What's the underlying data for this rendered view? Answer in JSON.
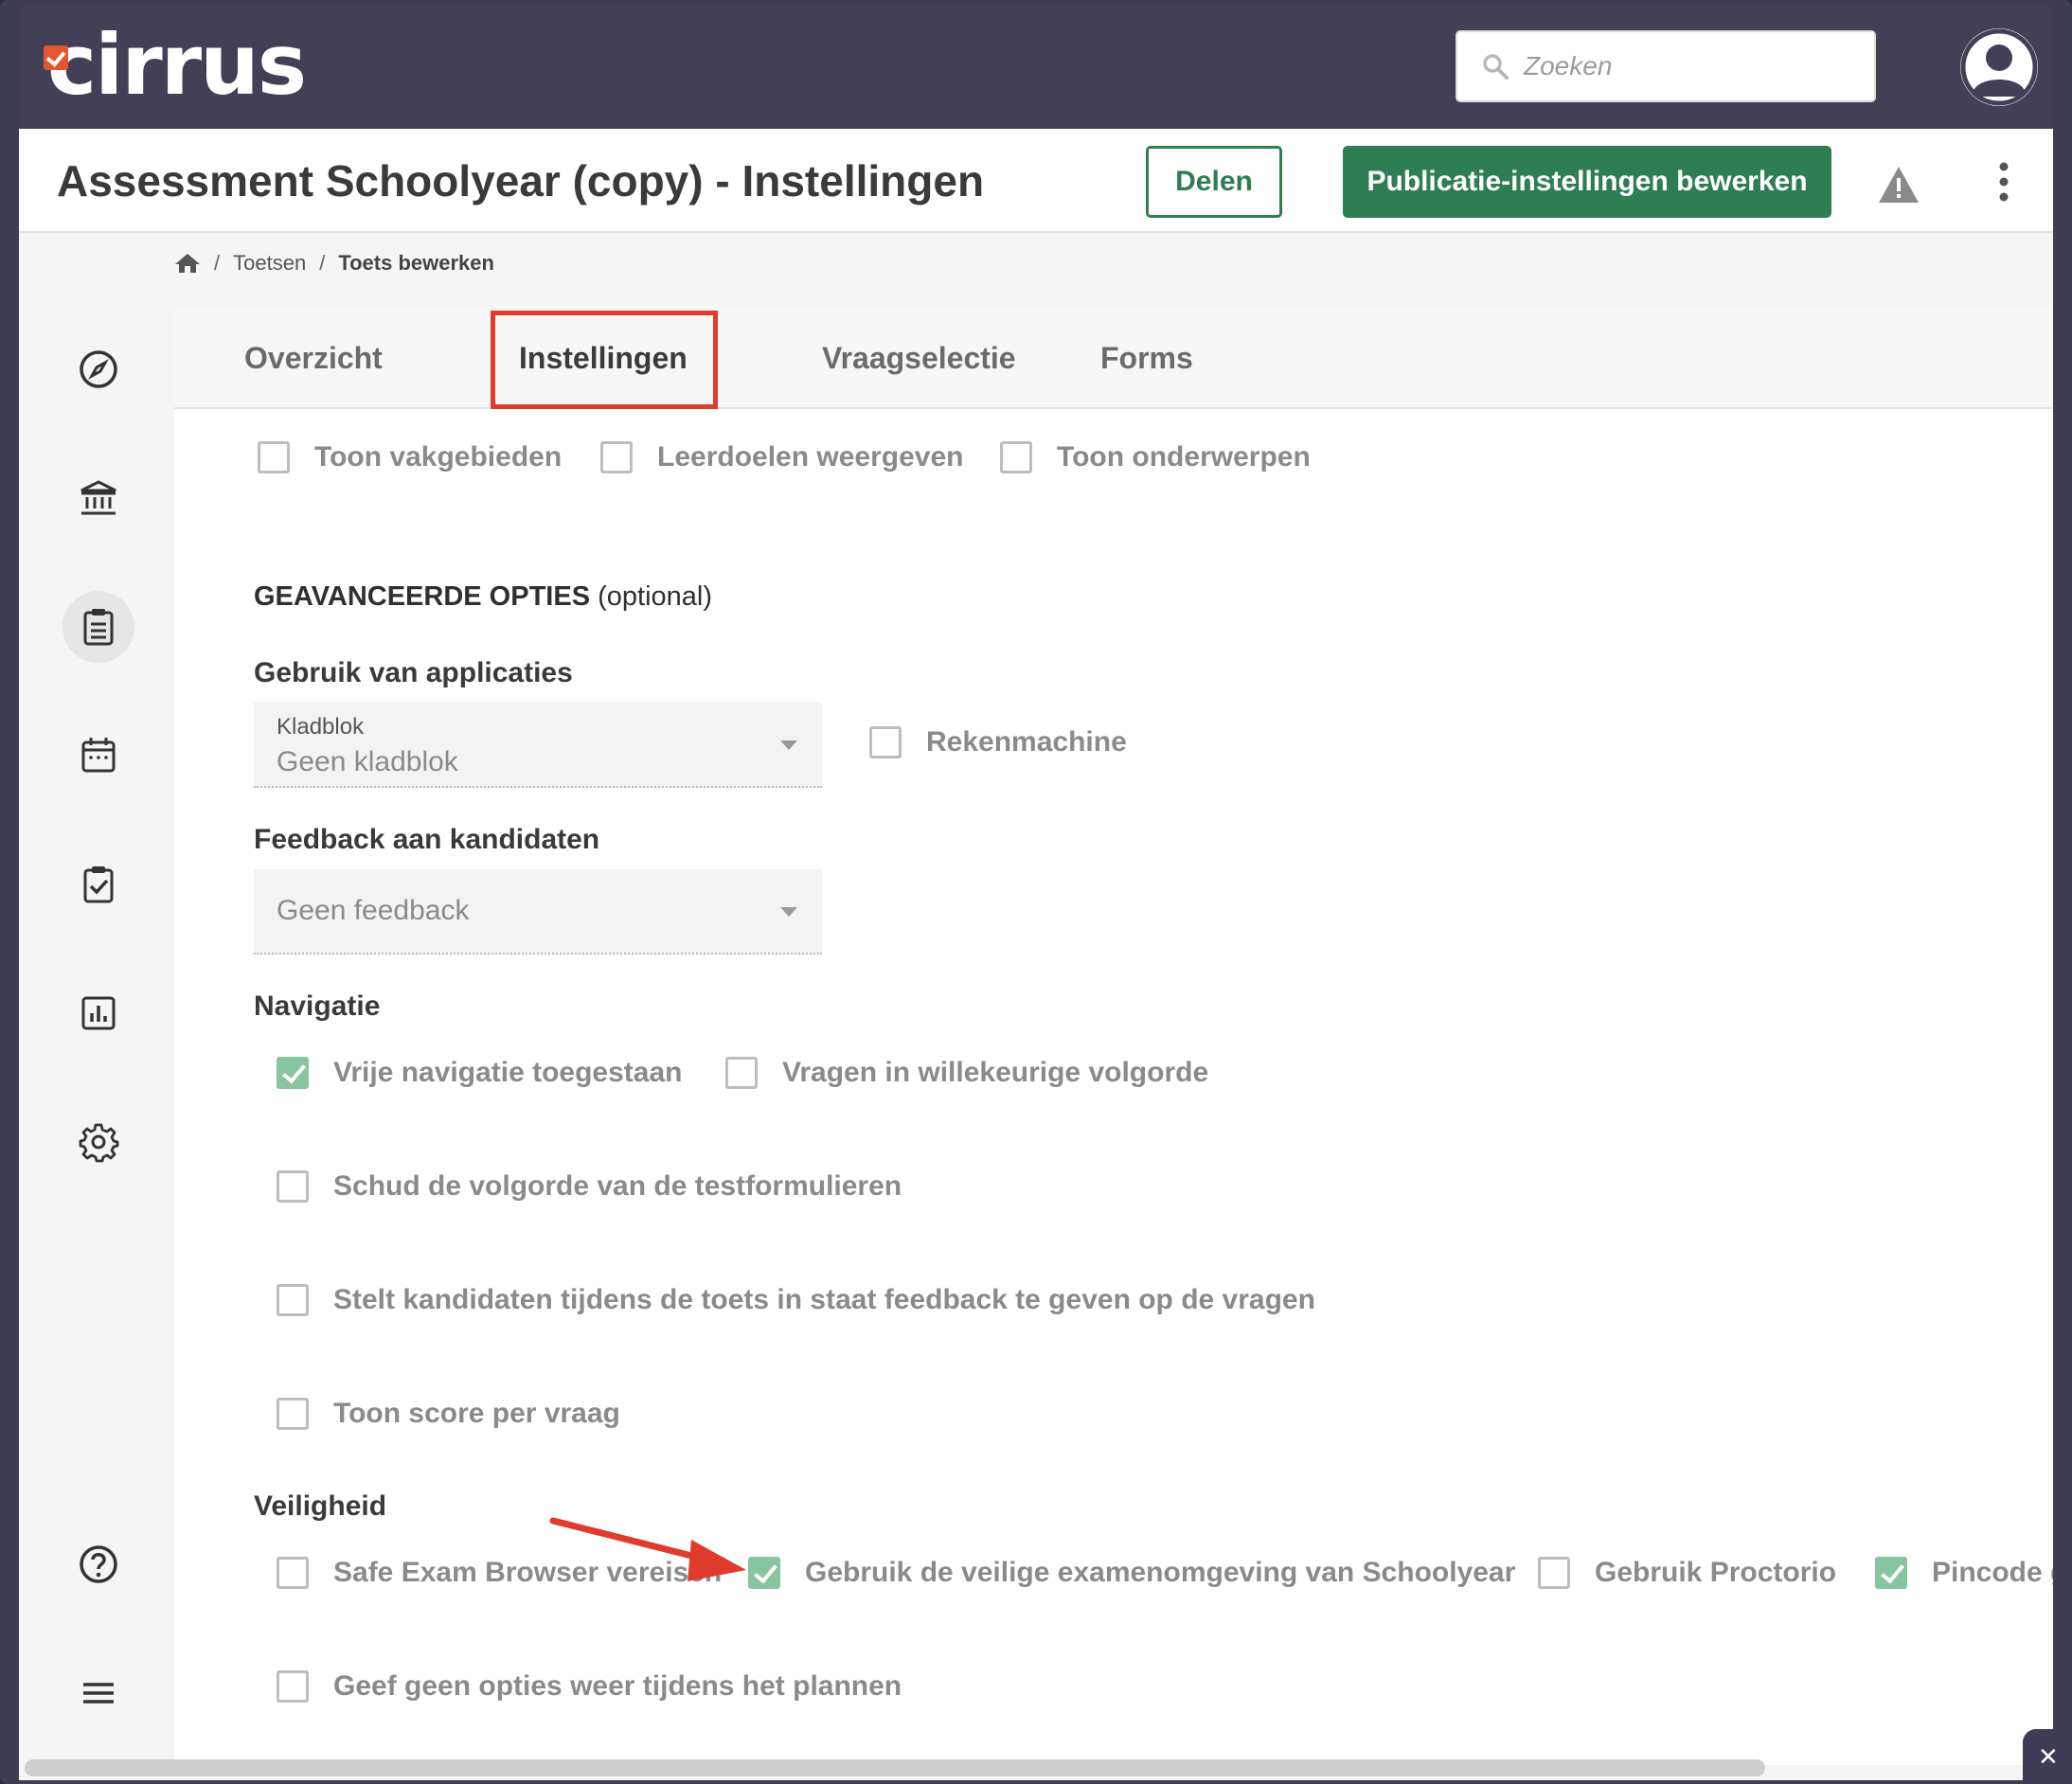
{
  "app": {
    "logo_text": "cirrus"
  },
  "search": {
    "placeholder": "Zoeken"
  },
  "header": {
    "title": "Assessment Schoolyear (copy) - Instellingen",
    "share_label": "Delen",
    "publish_label": "Publicatie-instellingen bewerken"
  },
  "breadcrumb": {
    "items": [
      "Toetsen",
      "Toets bewerken"
    ]
  },
  "tabs": [
    {
      "label": "Overzicht"
    },
    {
      "label": "Instellingen",
      "active": true
    },
    {
      "label": "Vraagselectie"
    },
    {
      "label": "Forms"
    }
  ],
  "display_options": [
    {
      "label": "Toon vakgebieden",
      "checked": false
    },
    {
      "label": "Leerdoelen weergeven",
      "checked": false
    },
    {
      "label": "Toon onderwerpen",
      "checked": false
    }
  ],
  "advanced": {
    "title": "GEAVANCEERDE OPTIES",
    "title_suffix": "(optional)"
  },
  "applications": {
    "label": "Gebruik van applicaties",
    "notepad_caption": "Kladblok",
    "notepad_value": "Geen kladblok",
    "calculator": {
      "label": "Rekenmachine",
      "checked": false
    }
  },
  "feedback": {
    "label": "Feedback aan kandidaten",
    "value": "Geen feedback"
  },
  "navigation": {
    "label": "Navigatie",
    "options": [
      {
        "label": "Vrije navigatie toegestaan",
        "checked": true
      },
      {
        "label": "Vragen in willekeurige volgorde",
        "checked": false
      },
      {
        "label": "Schud de volgorde van de testformulieren",
        "checked": false
      },
      {
        "label": "Stelt kandidaten tijdens de toets in staat feedback te geven op de vragen",
        "checked": false
      },
      {
        "label": "Toon score per vraag",
        "checked": false
      }
    ]
  },
  "security": {
    "label": "Veiligheid",
    "options": [
      {
        "label": "Safe Exam Browser vereisen",
        "checked": false
      },
      {
        "label": "Gebruik de veilige examenomgeving van Schoolyear",
        "checked": true
      },
      {
        "label": "Gebruik Proctorio",
        "checked": false
      },
      {
        "label": "Pincode ge",
        "checked": true
      },
      {
        "label": "Geef geen opties weer tijdens het plannen",
        "checked": false
      }
    ]
  },
  "colors": {
    "accent_green": "#2f7d52",
    "checked_green": "#86c5a0",
    "topbar": "#423f57",
    "highlight_red": "#e03c2d"
  }
}
